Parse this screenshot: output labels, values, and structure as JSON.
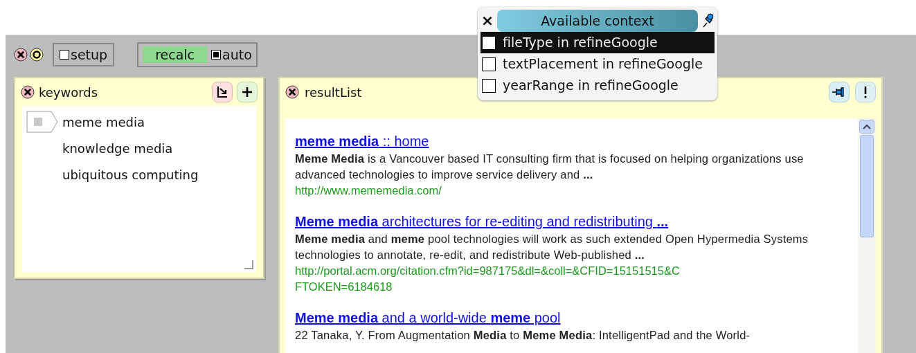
{
  "toolbar": {
    "setup": {
      "label": "setup",
      "checked": false
    },
    "recalc": {
      "label": "recalc"
    },
    "auto": {
      "label": "auto",
      "checked": true
    }
  },
  "keywords": {
    "title": "keywords",
    "items": [
      {
        "label": "meme media",
        "selected": true
      },
      {
        "label": "knowledge media",
        "selected": false
      },
      {
        "label": "ubiquitous computing",
        "selected": false
      }
    ]
  },
  "result_list": {
    "title": "resultList",
    "results": [
      {
        "title": "**meme media** :: home",
        "snippet": "**Meme Media** is a Vancouver based IT consulting firm that is focused on helping organizations use advanced technologies to improve service delivery and **...**",
        "url": "http://www.mememedia.com/"
      },
      {
        "title": "**Meme media** architectures for re-editing and redistributing **...**",
        "snippet": "**Meme media** and **meme** pool technologies will work as such extended Open Hypermedia Systems technologies to annotate, re-edit, and redistribute Web-published **...**",
        "url": "http://portal.acm.org/citation.cfm?id=987175&dl=&coll=&CFID=15151515&CFTOKEN=6184618"
      },
      {
        "title": "**Meme media** and a world-wide **meme** pool",
        "snippet": "22 Tanaka, Y. From Augmentation **Media** to **Meme Media**: IntelligentPad and the World-"
      }
    ]
  },
  "context_popup": {
    "close": "×",
    "title": "Available context",
    "items": [
      {
        "label": "fileType in refineGoogle",
        "checked": false,
        "selected": true
      },
      {
        "label": "textPlacement in refineGoogle",
        "checked": false,
        "selected": false
      },
      {
        "label": "yearRange in refineGoogle",
        "checked": false,
        "selected": false
      }
    ]
  }
}
